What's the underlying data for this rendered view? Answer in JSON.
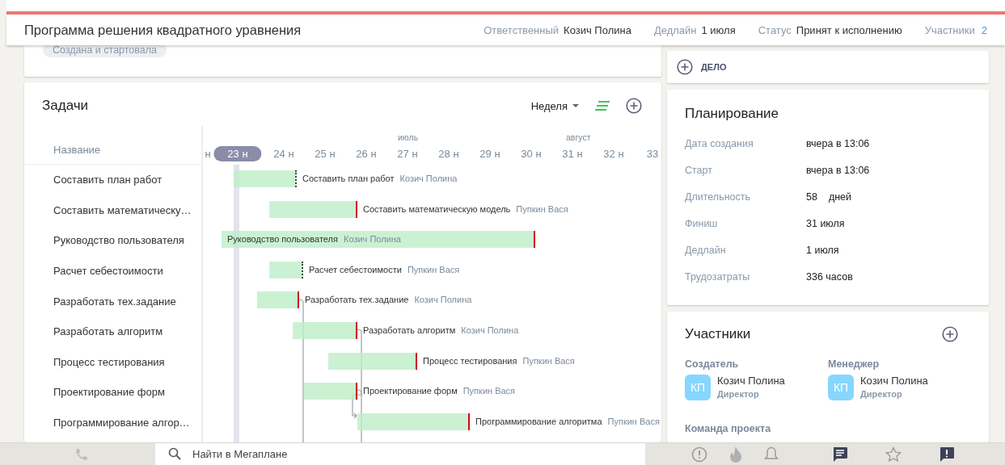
{
  "header": {
    "title": "Программа решения квадратного уравнения",
    "fields": [
      {
        "label": "Ответственный",
        "value": "Козич Полина"
      },
      {
        "label": "Дедлайн",
        "value": "1 июля"
      },
      {
        "label": "Статус",
        "value": "Принят к исполнению"
      }
    ],
    "participants": {
      "label": "Участники",
      "count": "2"
    }
  },
  "status_card": {
    "tag": "Создана и стартовала"
  },
  "tasks": {
    "title": "Задачи",
    "scale": "Неделя",
    "name_column": "Название",
    "months": [
      {
        "label": "июль"
      },
      {
        "label": "август"
      }
    ],
    "weeks": [
      {
        "label": "н",
        "selected": false
      },
      {
        "label": "23 н",
        "selected": true
      },
      {
        "label": "24 н",
        "selected": false
      },
      {
        "label": "25 н",
        "selected": false
      },
      {
        "label": "26 н",
        "selected": false
      },
      {
        "label": "27 н",
        "selected": false
      },
      {
        "label": "28 н",
        "selected": false
      },
      {
        "label": "29 н",
        "selected": false
      },
      {
        "label": "30 н",
        "selected": false
      },
      {
        "label": "31 н",
        "selected": false
      },
      {
        "label": "32 н",
        "selected": false
      },
      {
        "label": "33",
        "selected": false
      }
    ],
    "rows": [
      {
        "name": "Составить план работ",
        "bar_label": "Составить план работ",
        "assignee": "Козич Полина",
        "kind": "open-end"
      },
      {
        "name": "Составить математическу…",
        "bar_label": "Составить математическую модель",
        "assignee": "Пупкин Вася",
        "kind": "deadline-end"
      },
      {
        "name": "Руководство пользователя",
        "bar_label": "Руководство пользователя",
        "assignee": "Козич Полина",
        "kind": "deadline-end"
      },
      {
        "name": "Расчет себестоимости",
        "bar_label": "Расчет себестоимости",
        "assignee": "Пупкин Вася",
        "kind": "open-end"
      },
      {
        "name": "Разработать тех.задание",
        "bar_label": "Разработать тех.задание",
        "assignee": "Козич Полина",
        "kind": "deadline-end"
      },
      {
        "name": "Разработать алгоритм",
        "bar_label": "Разработать алгоритм",
        "assignee": "Козич Полина",
        "kind": "deadline-end"
      },
      {
        "name": "Процесс тестирования",
        "bar_label": "Процесс тестирования",
        "assignee": "Пупкин Вася",
        "kind": "deadline-end"
      },
      {
        "name": "Проектирование форм",
        "bar_label": "Проектирование форм",
        "assignee": "Пупкин Вася",
        "kind": "deadline-end"
      },
      {
        "name": "Программирование алгор…",
        "bar_label": "Программирование алгоритма",
        "assignee": "Пупкин Вася",
        "kind": "deadline-end"
      }
    ]
  },
  "action_card": {
    "label": "ДЕЛО"
  },
  "planning": {
    "title": "Планирование",
    "fields": [
      {
        "label": "Дата создания",
        "value": "вчера в 13:06"
      },
      {
        "label": "Старт",
        "value": "вчера в 13:06"
      },
      {
        "label": "Длительность",
        "value": "58",
        "unit": "дней"
      },
      {
        "label": "Финиш",
        "value": "31 июля"
      },
      {
        "label": "Дедлайн",
        "value": "1 июля"
      },
      {
        "label": "Трудозатраты",
        "value": "336 часов"
      }
    ]
  },
  "participants": {
    "title": "Участники",
    "roles": [
      {
        "role": "Создатель",
        "initials": "КП",
        "name": "Козич Полина",
        "position": "Директор"
      },
      {
        "role": "Менеджер",
        "initials": "КП",
        "name": "Козич Полина",
        "position": "Директор"
      }
    ],
    "team_label": "Команда проекта"
  },
  "bottom_bar": {
    "search_placeholder": "Найти в Мегаплане"
  }
}
